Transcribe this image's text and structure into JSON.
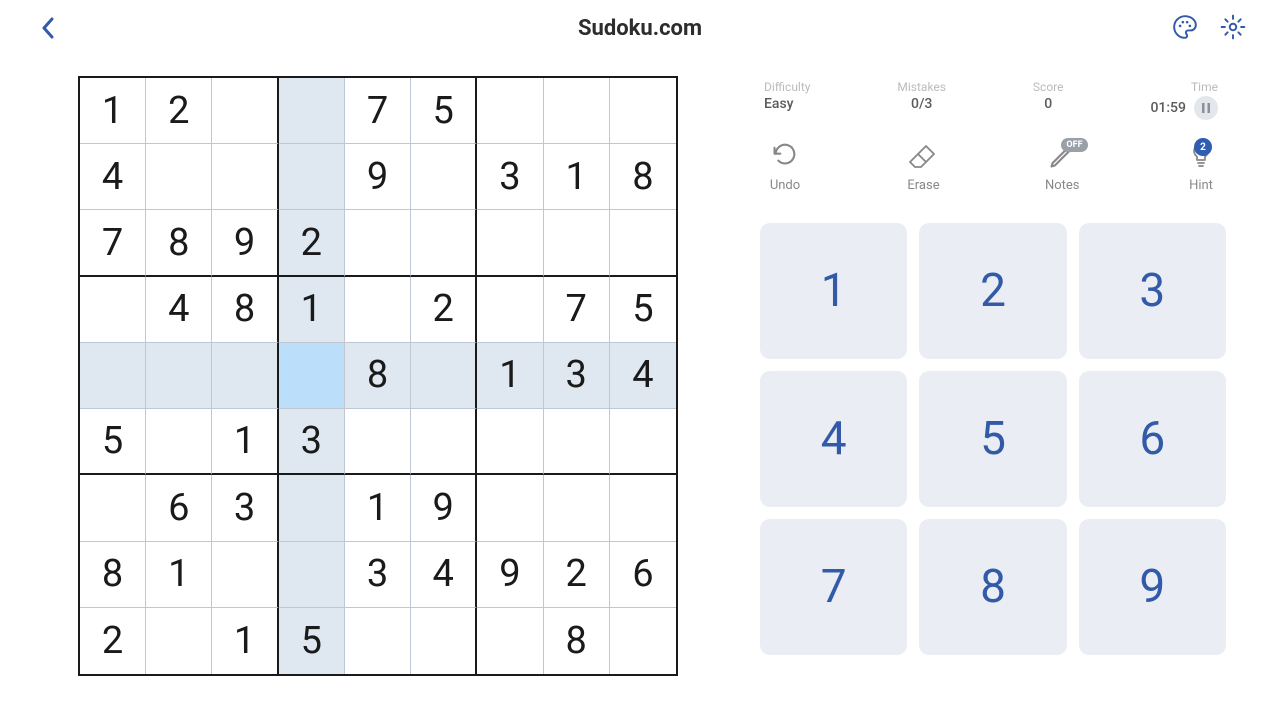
{
  "header": {
    "title": "Sudoku.com"
  },
  "stats": {
    "difficulty_label": "Difficulty",
    "difficulty_value": "Easy",
    "mistakes_label": "Mistakes",
    "mistakes_value": "0/3",
    "score_label": "Score",
    "score_value": "0",
    "time_label": "Time",
    "time_value": "01:59"
  },
  "actions": {
    "undo": "Undo",
    "erase": "Erase",
    "notes": "Notes",
    "notes_state": "OFF",
    "hint": "Hint",
    "hint_count": "2"
  },
  "numpad": [
    "1",
    "2",
    "3",
    "4",
    "5",
    "6",
    "7",
    "8",
    "9"
  ],
  "board": {
    "rows": [
      [
        "1",
        "2",
        "",
        "",
        "7",
        "5",
        "",
        "",
        ""
      ],
      [
        "4",
        "",
        "",
        "",
        "9",
        "",
        "3",
        "1",
        "8"
      ],
      [
        "7",
        "8",
        "9",
        "2",
        "",
        "",
        "",
        "",
        ""
      ],
      [
        "",
        "4",
        "8",
        "1",
        "",
        "2",
        "",
        "7",
        "5"
      ],
      [
        "",
        "",
        "",
        "",
        "8",
        "",
        "1",
        "3",
        "4"
      ],
      [
        "5",
        "",
        "1",
        "3",
        "",
        "",
        "",
        "",
        ""
      ],
      [
        "",
        "6",
        "3",
        "",
        "1",
        "9",
        "",
        "",
        ""
      ],
      [
        "8",
        "1",
        "",
        "",
        "3",
        "4",
        "9",
        "2",
        "6"
      ],
      [
        "2",
        "",
        "1",
        "5",
        "",
        "",
        "",
        "8",
        ""
      ]
    ],
    "selected": {
      "row": 5,
      "col": 4
    }
  }
}
